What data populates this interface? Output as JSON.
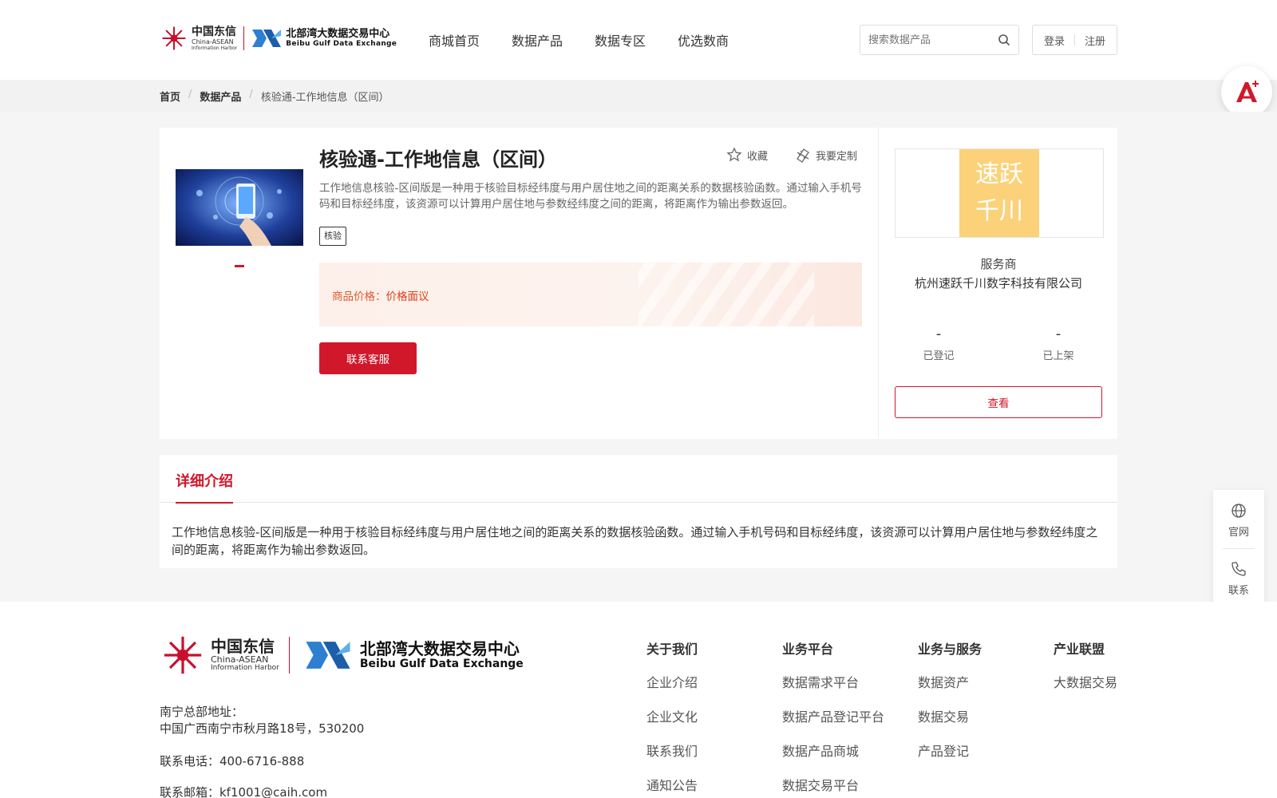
{
  "header": {
    "logo_cn": "中国东信",
    "logo_en1": "China-ASEAN",
    "logo_en2": "Information Harbor",
    "exchange_cn": "北部湾大数据交易中心",
    "exchange_en": "Beibu Gulf Data Exchange",
    "nav": [
      "商城首页",
      "数据产品",
      "数据专区",
      "优选数商"
    ],
    "search_placeholder": "搜索数据产品",
    "login": "登录",
    "register": "注册"
  },
  "breadcrumb": [
    "首页",
    "数据产品",
    "核验通-工作地信息（区间）"
  ],
  "product": {
    "title": "核验通-工作地信息（区间）",
    "favorite_label": "收藏",
    "custom_label": "我要定制",
    "description": "工作地信息核验-区间版是一种用于核验目标经纬度与用户居住地之间的距离关系的数据核验函数。通过输入手机号码和目标经纬度，该资源可以计算用户居住地与参数经纬度之间的距离，将距离作为输出参数返回。",
    "tag": "核验",
    "price_label": "商品价格：",
    "price_value": "价格面议",
    "contact_button": "联系客服"
  },
  "vendor": {
    "logo_line1": "速跃",
    "logo_line2": "千川",
    "role": "服务商",
    "name": "杭州速跃千川数字科技有限公司",
    "registered_value": "-",
    "registered_label": "已登记",
    "listed_value": "-",
    "listed_label": "已上架",
    "view_button": "查看"
  },
  "detail": {
    "tab": "详细介绍",
    "body": "工作地信息核验-区间版是一种用于核验目标经纬度与用户居住地之间的距离关系的数据核验函数。通过输入手机号码和目标经纬度，该资源可以计算用户居住地与参数经纬度之间的距离，将距离作为输出参数返回。"
  },
  "toolbar": {
    "website": "官网",
    "contact": "联系"
  },
  "footer": {
    "address_label": "南宁总部地址：",
    "address": "中国广西南宁市秋月路18号，530200",
    "phone": "联系电话：400-6716-888",
    "email": "联系邮箱：kf1001@caih.com",
    "columns": [
      {
        "title": "关于我们",
        "items": [
          "企业介绍",
          "企业文化",
          "联系我们",
          "通知公告"
        ]
      },
      {
        "title": "业务平台",
        "items": [
          "数据需求平台",
          "数据产品登记平台",
          "数据产品商城",
          "数据交易平台"
        ]
      },
      {
        "title": "业务与服务",
        "items": [
          "数据资产",
          "数据交易",
          "产品登记"
        ]
      },
      {
        "title": "产业联盟",
        "items": [
          "大数据交易"
        ]
      }
    ]
  },
  "colors": {
    "brand_red": "#d1182b",
    "price_orange": "#e0401a",
    "vendor_logo_bg": "#fbd27a"
  }
}
